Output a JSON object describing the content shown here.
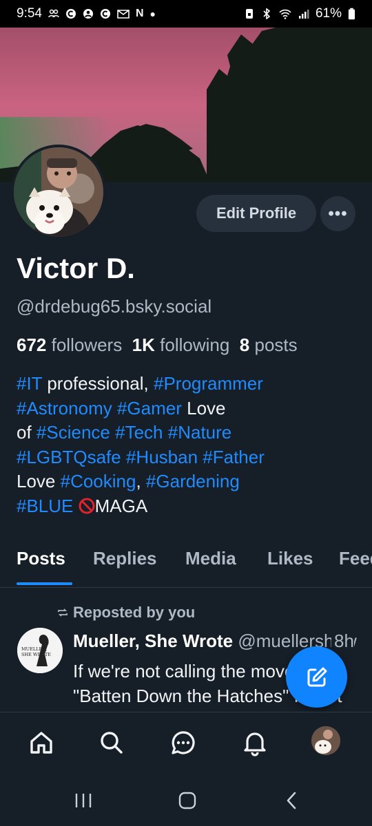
{
  "status_bar": {
    "time": "9:54",
    "left_icons": [
      "people-icon",
      "c-icon",
      "account-icon",
      "c-icon",
      "gmail-icon",
      "netflix-icon",
      "dot-icon"
    ],
    "right_icons": [
      "lock-icon",
      "bluetooth-icon",
      "wifi-icon",
      "signal-icon",
      "battery-icon"
    ],
    "battery": "61%"
  },
  "profile": {
    "display_name": "Victor D.",
    "handle": "@drdebug65.bsky.social",
    "followers_count": "672",
    "followers_label": "followers",
    "following_count": "1K",
    "following_label": "following",
    "posts_count": "8",
    "posts_label": "posts",
    "edit_button": "Edit Profile",
    "more_button": "•••"
  },
  "bio": {
    "line1": {
      "t1": "#IT",
      "p1": " professional, ",
      "t2": "#Programmer"
    },
    "line2": {
      "t1": "#Astronomy",
      "p1": " ",
      "t2": "#Gamer",
      "p2": " Love"
    },
    "line3": {
      "p0": "of ",
      "t1": "#Science",
      "p1": " ",
      "t2": "#Tech",
      "p2": " ",
      "t3": "#Nature"
    },
    "line4": {
      "t1": "#LGBTQsafe",
      "p1": " ",
      "t2": "#Husban",
      "p2": " ",
      "t3": "#Father"
    },
    "line5": {
      "p0": "Love ",
      "t1": "#Cooking",
      "p1": ", ",
      "t2": "#Gardening"
    },
    "line6": {
      "t1": "#BLUE",
      "p1": " ",
      "p2": "MAGA"
    }
  },
  "tabs": [
    "Posts",
    "Replies",
    "Media",
    "Likes",
    "Feeds"
  ],
  "active_tab": "Posts",
  "post": {
    "repost_label": "Reposted by you",
    "author_name": "Mueller, She Wrote",
    "author_handle": "@muellershewrote.com",
    "time": "8h",
    "text": "If we're not calling the movement \"Batten Down the Hatches\" I don't know what",
    "avatar_text": "MUELLER, SHE WROTE"
  },
  "bottom_nav": [
    "home-icon",
    "search-icon",
    "chat-icon",
    "bell-icon",
    "profile-avatar"
  ],
  "colors": {
    "background": "#161e27",
    "accent": "#208bfe",
    "fab": "#1083fe",
    "muted": "#aeb9c5"
  }
}
